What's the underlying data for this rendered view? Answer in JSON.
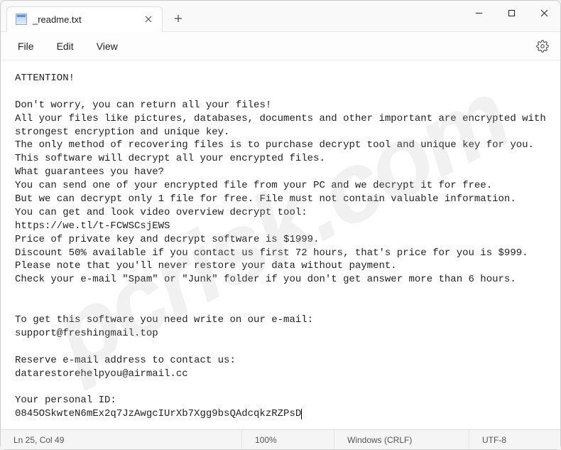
{
  "titlebar": {
    "tab_title": "_readme.txt"
  },
  "menu": {
    "file": "File",
    "edit": "Edit",
    "view": "View"
  },
  "document": {
    "body": "ATTENTION!\n\nDon't worry, you can return all your files!\nAll your files like pictures, databases, documents and other important are encrypted with strongest encryption and unique key.\nThe only method of recovering files is to purchase decrypt tool and unique key for you.\nThis software will decrypt all your encrypted files.\nWhat guarantees you have?\nYou can send one of your encrypted file from your PC and we decrypt it for free.\nBut we can decrypt only 1 file for free. File must not contain valuable information.\nYou can get and look video overview decrypt tool:\nhttps://we.tl/t-FCWSCsjEWS\nPrice of private key and decrypt software is $1999.\nDiscount 50% available if you contact us first 72 hours, that's price for you is $999.\nPlease note that you'll never restore your data without payment.\nCheck your e-mail \"Spam\" or \"Junk\" folder if you don't get answer more than 6 hours.\n\n\nTo get this software you need write on our e-mail:\nsupport@freshingmail.top\n\nReserve e-mail address to contact us:\ndatarestorehelpyou@airmail.cc\n\nYour personal ID:\n0845OSkwteN6mEx2q7JzAwgcIUrXb7Xgg9bsQAdcqkzRZPsD"
  },
  "statusbar": {
    "position": "Ln 25, Col 49",
    "zoom": "100%",
    "lineending": "Windows (CRLF)",
    "encoding": "UTF-8"
  },
  "watermark": "pcrisk.com"
}
